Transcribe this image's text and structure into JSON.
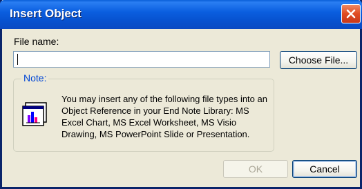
{
  "window": {
    "title": "Insert Object"
  },
  "file_name": {
    "label": "File name:",
    "value": "",
    "choose_button": "Choose File..."
  },
  "note": {
    "legend": "Note:",
    "icon": "embedded-chart-icon",
    "text": "You may insert any of the following file types into an Object Reference in your End Note Library: MS Excel Chart, MS Excel Worksheet, MS Visio Drawing, MS PowerPoint Slide or Presentation."
  },
  "buttons": {
    "ok": "OK",
    "cancel": "Cancel"
  },
  "colors": {
    "titlebar": "#0b5fe0",
    "window_bg": "#ece9d8",
    "legend_text": "#0046d5",
    "close_button": "#e04b22"
  }
}
